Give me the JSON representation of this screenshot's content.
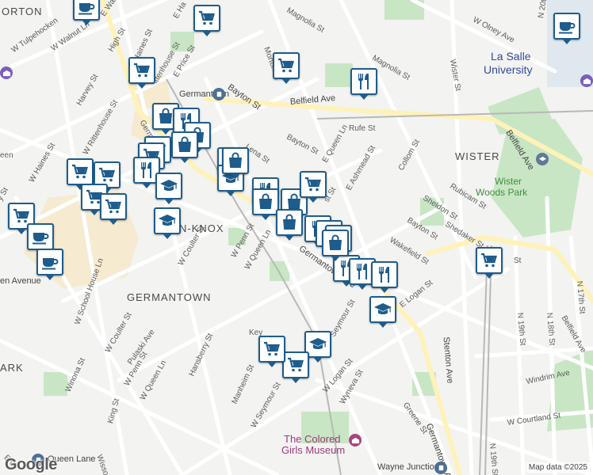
{
  "map": {
    "attribution": "Map data ©2025",
    "logo": "Google",
    "colors": {
      "park": "#c8e6c4",
      "campus": "#f6ead0",
      "pin_border": "#1e5c8c",
      "pin_icon": "#1e5c8c",
      "road": "#ffffff",
      "background": "#f3f3f1"
    }
  },
  "labels": {
    "neighborhoods": [
      "GERMANTOWN",
      "WISTER",
      "ORTON",
      "N-KNOX",
      "ARK"
    ],
    "places": [
      "La Salle",
      "University",
      "Wister",
      "Woods Park",
      "The Colored",
      "Girls Museum",
      "Germantown",
      "Queen Lane",
      "Wayne Junction",
      "en Avenue"
    ],
    "streets": [
      "W Tulpehocken",
      "W Walnut Ln",
      "E Walr",
      "E Ha",
      "High St",
      "Haines St",
      "E Price St",
      "ittenhouse St",
      "Harvey St",
      "W Rittenhouse St",
      "Germa",
      "W Haines St",
      "een",
      "y St",
      "Morton St",
      "Magnolia St",
      "Magnolia St",
      "W Olney Ave",
      "Wister St",
      "Bayton St",
      "Belfield Ave",
      "Rufe St",
      "Bayton St",
      "Lena St",
      "E Queen Ln",
      "E Ashmead St",
      "Collom St",
      "Belfield Ave",
      "Rubicam St",
      "Sheldon St",
      "Bayton St",
      "Shedaker St",
      "Wakefield St",
      "E Logan St",
      "Germantown Ave",
      "W Coulter St",
      "W Penn St",
      "W Queen Ln",
      "st St",
      "Seymour St",
      "W School House Ln",
      "W Coulter St",
      "Pulaski Ave",
      "W Penn St",
      "W Queen Ln",
      "Hansberry St",
      "Winona St",
      "King St",
      "Manheim St",
      "W Seymour St",
      "Wyneva St",
      "W Logan St",
      "Greene St",
      "Germantown Ave",
      "Stenton Ave",
      "N 19th St",
      "N 18th St",
      "N 20th St",
      "Windrim Ave",
      "W Courtland St",
      "N 19th St",
      "N 17th St",
      "Belfield Ave",
      "Key",
      "Wisso",
      "St",
      "E 0"
    ]
  },
  "pins": [
    {
      "icon": "coffee"
    },
    {
      "icon": "cart"
    },
    {
      "icon": "coffee"
    },
    {
      "icon": "cart"
    },
    {
      "icon": "cart"
    },
    {
      "icon": "fork-knife"
    },
    {
      "icon": "bag"
    },
    {
      "icon": "fork-knife"
    },
    {
      "icon": "bag"
    },
    {
      "icon": "cart"
    },
    {
      "icon": "bag"
    },
    {
      "icon": "cart"
    },
    {
      "icon": "cart"
    },
    {
      "icon": "fork-knife"
    },
    {
      "icon": "graduation-cap"
    },
    {
      "icon": "cart"
    },
    {
      "icon": "cart"
    },
    {
      "icon": "graduation-cap"
    },
    {
      "icon": "cart"
    },
    {
      "icon": "cart"
    },
    {
      "icon": "graduation-cap"
    },
    {
      "icon": "coffee"
    },
    {
      "icon": "coffee"
    },
    {
      "icon": "graduation-cap"
    },
    {
      "icon": "bag"
    },
    {
      "icon": "fork-knife"
    },
    {
      "icon": "bag"
    },
    {
      "icon": "bag"
    },
    {
      "icon": "cart"
    },
    {
      "icon": "bag"
    },
    {
      "icon": "fork-knife"
    },
    {
      "icon": "bag"
    },
    {
      "icon": "fork-knife"
    },
    {
      "icon": "fork-knife"
    },
    {
      "icon": "fork-knife"
    },
    {
      "icon": "graduation-cap"
    },
    {
      "icon": "cart"
    },
    {
      "icon": "fork-knife"
    },
    {
      "icon": "bag"
    },
    {
      "icon": "graduation-cap"
    },
    {
      "icon": "cart"
    },
    {
      "icon": "cart"
    }
  ]
}
